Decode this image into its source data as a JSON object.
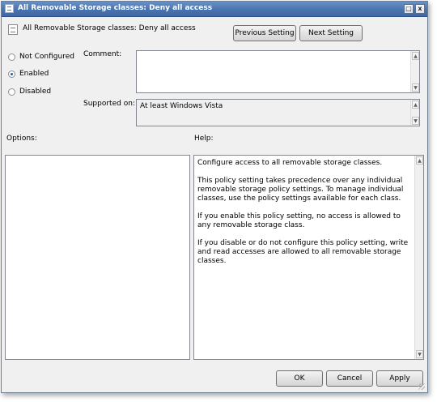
{
  "window": {
    "title": "All Removable Storage classes: Deny all access",
    "maximize_glyph": "□",
    "close_glyph": "x"
  },
  "header": {
    "policy_name": "All Removable Storage classes: Deny all access",
    "previous_button": "Previous Setting",
    "next_button": "Next Setting"
  },
  "state": {
    "options": [
      {
        "label": "Not Configured",
        "selected": false
      },
      {
        "label": "Enabled",
        "selected": true
      },
      {
        "label": "Disabled",
        "selected": false
      }
    ]
  },
  "comment": {
    "label": "Comment:",
    "value": ""
  },
  "supported": {
    "label": "Supported on:",
    "value": "At least Windows Vista"
  },
  "options_panel": {
    "label": "Options:"
  },
  "help_panel": {
    "label": "Help:",
    "paragraphs": [
      "Configure access to all removable storage classes.",
      "This policy setting takes precedence over any individual removable storage policy settings. To manage individual classes, use the policy settings available for each class.",
      "If you enable this policy setting, no access is allowed to any removable storage class.",
      "If you disable or do not configure this policy setting, write and read accesses are allowed to all removable storage classes."
    ]
  },
  "footer": {
    "ok": "OK",
    "cancel": "Cancel",
    "apply": "Apply"
  },
  "icons": {
    "scroll_up": "▲",
    "scroll_down": "▼"
  }
}
